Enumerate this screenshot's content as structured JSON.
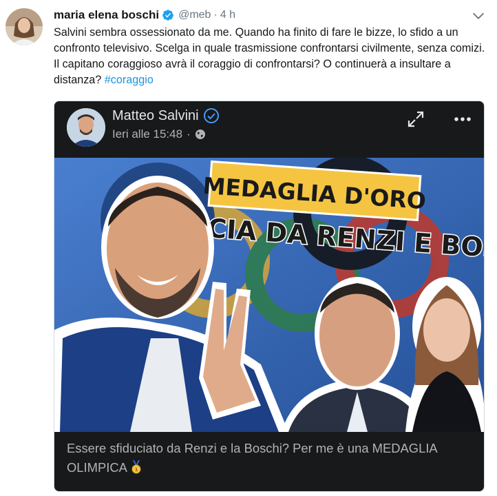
{
  "tweet": {
    "author_name": "maria elena boschi",
    "handle": "@meb",
    "separator": "·",
    "time": "4 h",
    "text": "Salvini sembra ossessionato da me. Quando ha finito di fare le bizze, lo sfido a un confronto televisivo. Scelga in quale trasmissione confrontarsi civilmente, senza comizi. Il capitano coraggioso avrà il coraggio di confrontarsi? O continuerà a insultare a distanza?",
    "hashtag": "#coraggio"
  },
  "card": {
    "author_name": "Matteo Salvini",
    "time": "Ieri alle 15:48",
    "separator": "·",
    "image_headline_line1": "MEDAGLIA D'ORO",
    "image_headline_line2": "SFIDUCIA DA RENZI E BOSCHI",
    "caption": "Essere sfiduciato da Renzi e la Boschi? Per me è una MEDAGLIA OLIMPICA"
  },
  "colors": {
    "link": "#1b95e0",
    "verified": "#1da1f2",
    "card_bg": "#18191a",
    "headline_yellow": "#f5c542",
    "photo_bg": "#2b5fa8"
  },
  "icons": [
    "verified-badge-icon",
    "chevron-down-icon",
    "expand-icon",
    "more-options-icon",
    "globe-icon",
    "gold-medal-icon"
  ]
}
